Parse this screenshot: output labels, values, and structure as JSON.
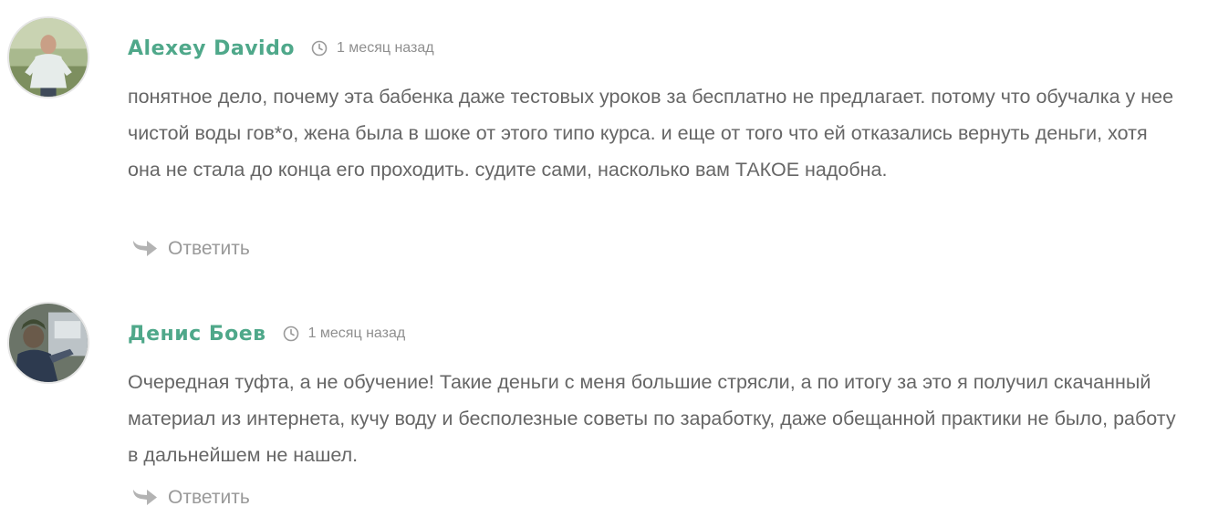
{
  "comments": [
    {
      "author": "Alexey Davido",
      "time": "1 месяц назад",
      "text": "понятное дело, почему эта бабенка даже тестовых уроков за бесплатно не предлагает. потому что обучалка у нее чистой воды гов*о, жена была в шоке от этого типо курса. и еще от того что ей отказались вернуть деньги, хотя она не стала до конца его проходить. судите сами, насколько вам ТАКОЕ надобна.",
      "reply_label": "Ответить"
    },
    {
      "author": "Денис Боев",
      "time": "1 месяц назад",
      "text": "Очередная туфта, а не обучение! Такие деньги с меня большие стрясли, а по итогу за это я получил скачанный материал из интернета, кучу воду и бесполезные советы по заработку, даже обещанной практики не было, работу в дальнейшем не нашел.",
      "reply_label": "Ответить"
    }
  ],
  "colors": {
    "author": "#4fa88a",
    "text": "#666666",
    "meta": "#8f8f8f",
    "reply": "#999999"
  },
  "icons": {
    "time": "clock-icon",
    "reply": "reply-arrow-icon"
  }
}
